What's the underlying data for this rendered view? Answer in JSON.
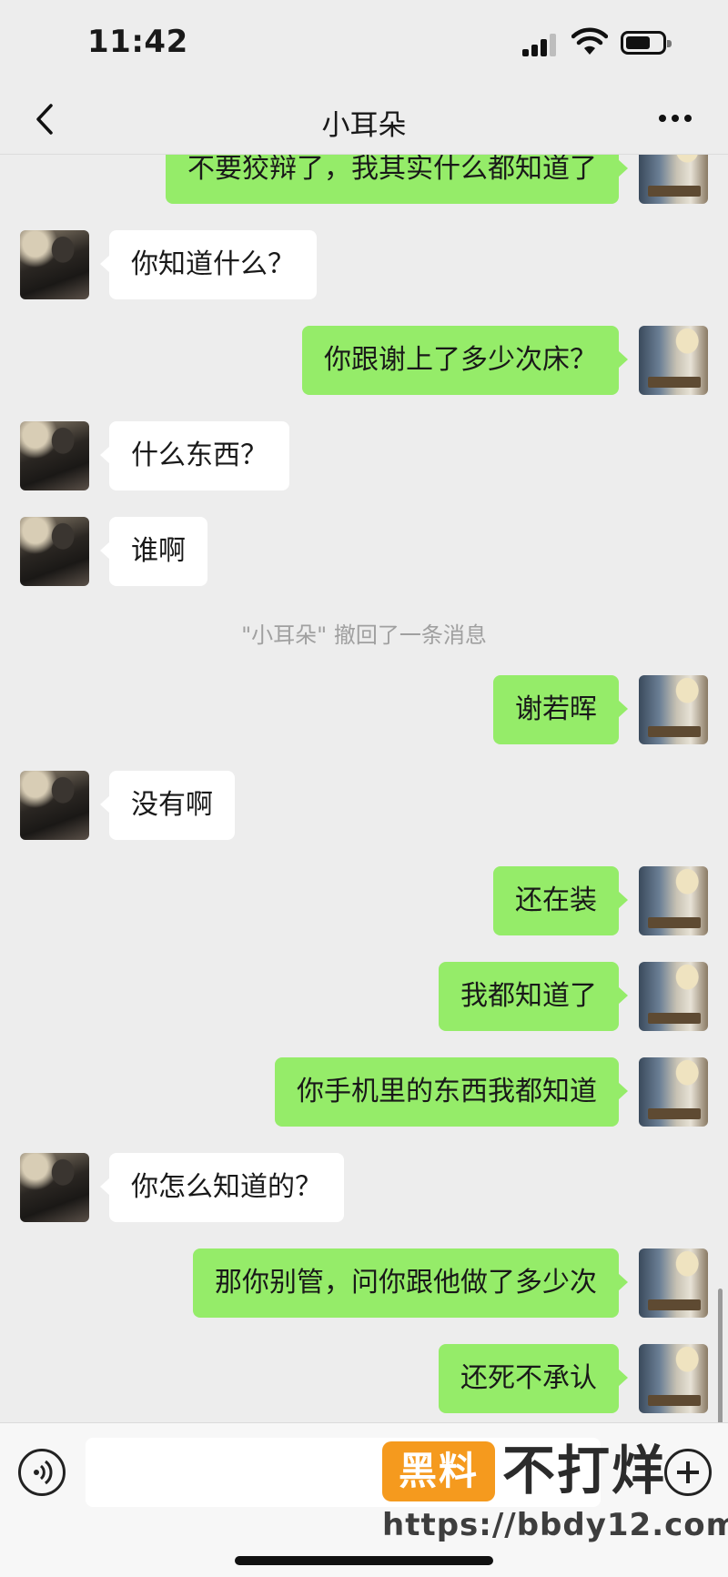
{
  "status_bar": {
    "time": "11:42"
  },
  "header": {
    "title": "小耳朵"
  },
  "messages": [
    {
      "side": "right",
      "text": "不要狡辩了，我其实什么都知道了"
    },
    {
      "side": "left",
      "text": "你知道什么？"
    },
    {
      "side": "right",
      "text": "你跟谢上了多少次床？"
    },
    {
      "side": "left",
      "text": "什么东西？"
    },
    {
      "side": "left",
      "text": "谁啊"
    },
    {
      "side": "system",
      "text": "\"小耳朵\" 撤回了一条消息"
    },
    {
      "side": "right",
      "text": "谢若晖"
    },
    {
      "side": "left",
      "text": "没有啊"
    },
    {
      "side": "right",
      "text": "还在装"
    },
    {
      "side": "right",
      "text": "我都知道了"
    },
    {
      "side": "right",
      "text": "你手机里的东西我都知道"
    },
    {
      "side": "left",
      "text": "你怎么知道的？"
    },
    {
      "side": "right",
      "text": "那你别管，问你跟他做了多少次"
    },
    {
      "side": "right",
      "text": "还死不承认"
    }
  ],
  "input_bar": {
    "value": ""
  },
  "watermark": {
    "badge": "黑料",
    "text": "不打烊",
    "url": "https://bbdy12.com"
  },
  "colors": {
    "background": "#ededed",
    "outgoing_bubble": "#95ec69",
    "incoming_bubble": "#ffffff",
    "watermark_badge": "#f59a1e"
  },
  "icons": {
    "back": "chevron-left-icon",
    "more": "more-dots-icon",
    "voice": "voice-icon",
    "plus": "plus-icon"
  }
}
